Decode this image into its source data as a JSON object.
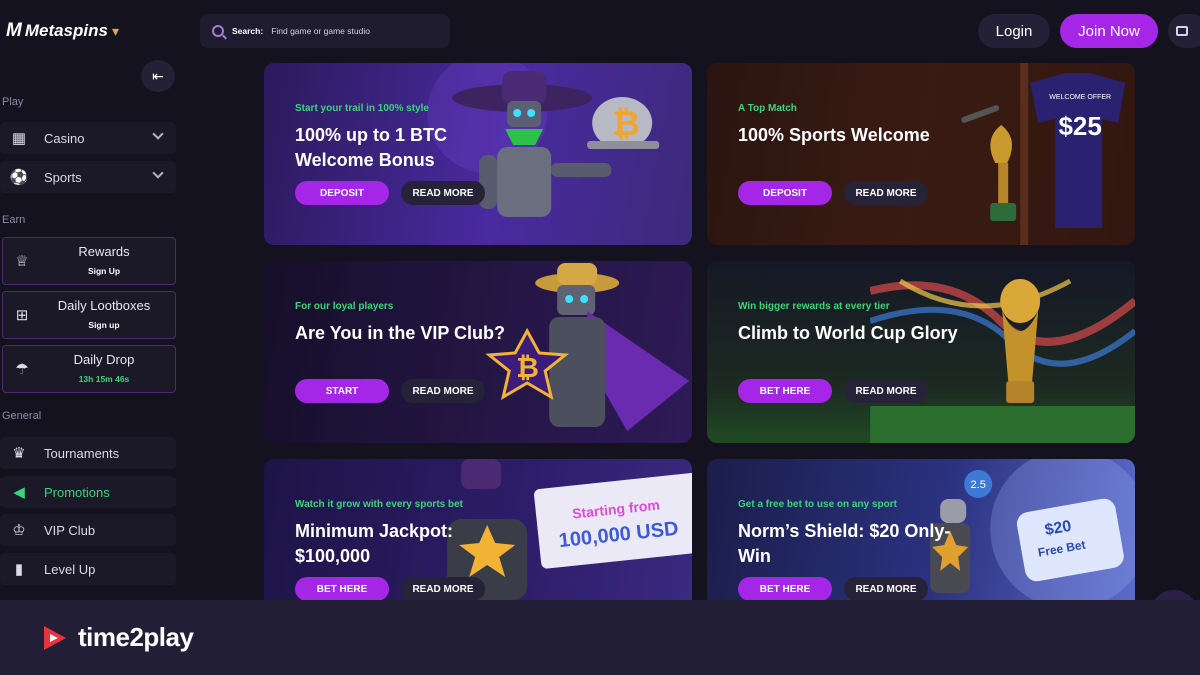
{
  "header": {
    "logo_text": "Metaspins",
    "logo_mark": "M",
    "search_label": "Search:",
    "search_placeholder": "Find game or game studio",
    "login_label": "Login",
    "join_label": "Join Now"
  },
  "sidebar": {
    "collapse_glyph": "⇤",
    "play_label": "Play",
    "play_items": [
      {
        "label": "Casino",
        "icon": "casino-icon"
      },
      {
        "label": "Sports",
        "icon": "soccer-ball-icon"
      }
    ],
    "earn_label": "Earn",
    "earn_items": [
      {
        "title": "Rewards",
        "sub": "Sign Up",
        "icon": "trophy-cup-icon"
      },
      {
        "title": "Daily Lootboxes",
        "sub": "Sign up",
        "icon": "lootbox-icon"
      },
      {
        "title": "Daily Drop",
        "sub": "13h 15m 46s",
        "icon": "parachute-icon"
      }
    ],
    "general_label": "General",
    "general_items": [
      {
        "label": "Tournaments",
        "icon": "trophy-icon"
      },
      {
        "label": "Promotions",
        "icon": "megaphone-icon"
      },
      {
        "label": "VIP Club",
        "icon": "crown-icon"
      },
      {
        "label": "Level Up",
        "icon": "bar-chart-icon"
      }
    ]
  },
  "promos": [
    {
      "eyebrow": "Start your trail in 100% style",
      "title": "100% up to 1 BTC Welcome Bonus",
      "primary": "DEPOSIT",
      "secondary": "READ MORE"
    },
    {
      "eyebrow": "A Top Match",
      "title": "100% Sports Welcome",
      "primary": "DEPOSIT",
      "secondary": "READ MORE",
      "art_text_top": "WELCOME OFFER",
      "art_text_big": "$25"
    },
    {
      "eyebrow": "For our loyal players",
      "title": "Are You in the VIP Club?",
      "primary": "START",
      "secondary": "READ MORE"
    },
    {
      "eyebrow": "Win bigger rewards at every tier",
      "title": "Climb to World Cup Glory",
      "primary": "BET HERE",
      "secondary": "READ MORE"
    },
    {
      "eyebrow": "Watch it grow with every sports bet",
      "title": "Minimum Jackpot: $100,000",
      "primary": "BET HERE",
      "secondary": "READ MORE",
      "art_text_top": "Starting from",
      "art_text_big": "100,000 USD"
    },
    {
      "eyebrow": "Get a free bet to use on any sport",
      "title": "Norm’s Shield: $20 Only-Win",
      "primary": "BET HERE",
      "secondary": "READ MORE",
      "art_text_top": "$20",
      "art_text_big": "Free Bet",
      "art_badge": "2.5"
    }
  ],
  "footer": {
    "brand": "time2play"
  },
  "colors": {
    "accent": "#a626e8",
    "green": "#37d67a",
    "bg": "#14121f"
  }
}
